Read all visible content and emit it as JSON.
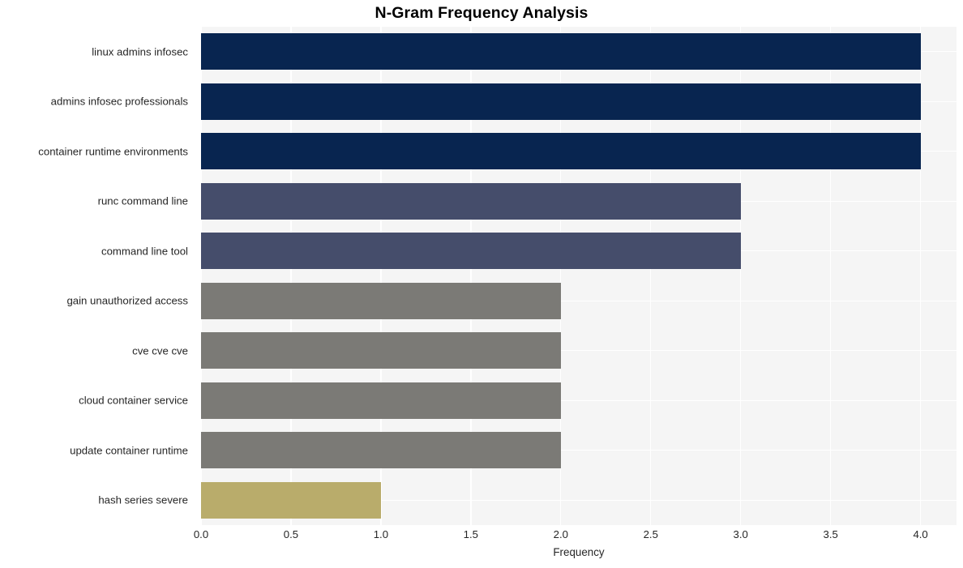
{
  "chart_data": {
    "type": "bar",
    "orientation": "horizontal",
    "title": "N-Gram Frequency Analysis",
    "xlabel": "Frequency",
    "ylabel": "",
    "categories": [
      "linux admins infosec",
      "admins infosec professionals",
      "container runtime environments",
      "runc command line",
      "command line tool",
      "gain unauthorized access",
      "cve cve cve",
      "cloud container service",
      "update container runtime",
      "hash series severe"
    ],
    "values": [
      4,
      4,
      4,
      3,
      3,
      2,
      2,
      2,
      2,
      1
    ],
    "bar_colors": [
      "#082550",
      "#082550",
      "#082550",
      "#454d6b",
      "#454d6b",
      "#7b7a76",
      "#7b7a76",
      "#7b7a76",
      "#7b7a76",
      "#b9ac6b"
    ],
    "xlim": [
      0,
      4.2
    ],
    "xticks": [
      0.0,
      0.5,
      1.0,
      1.5,
      2.0,
      2.5,
      3.0,
      3.5,
      4.0
    ],
    "xtick_labels": [
      "0.0",
      "0.5",
      "1.0",
      "1.5",
      "2.0",
      "2.5",
      "3.0",
      "3.5",
      "4.0"
    ],
    "grid": true,
    "grid_color": "#ffffff",
    "plot_background": "#f5f5f5",
    "figure_background": "#ffffff",
    "legend": null
  }
}
